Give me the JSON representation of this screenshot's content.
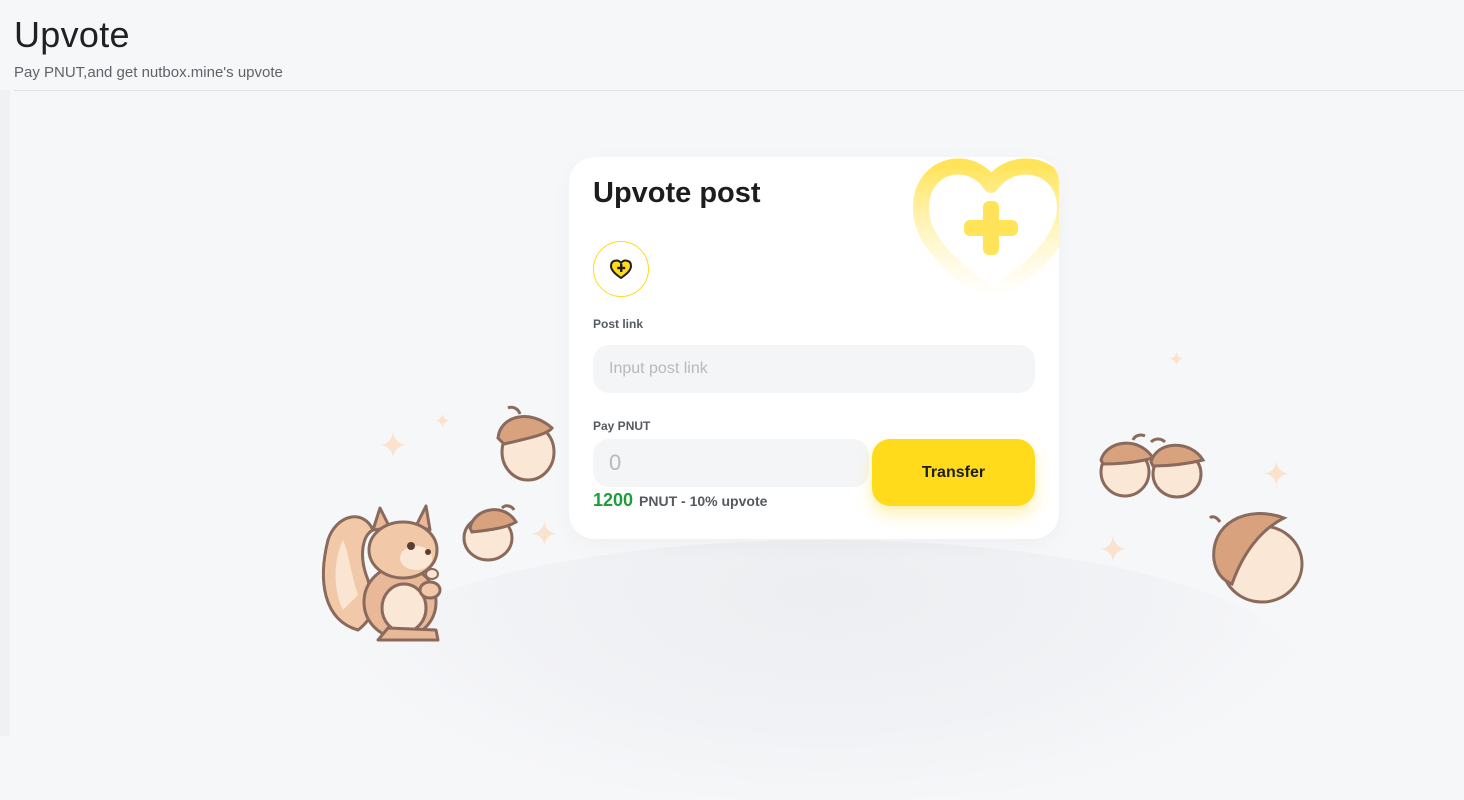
{
  "page": {
    "title": "Upvote",
    "subtitle": "Pay PNUT,and get nutbox.mine's upvote"
  },
  "card": {
    "title": "Upvote post",
    "post_link_label": "Post link",
    "post_link_placeholder": "Input post link",
    "pay_label": "Pay PNUT",
    "pay_placeholder": "0",
    "transfer_label": "Transfer",
    "pay_amount": "1200",
    "pay_description": "PNUT - 10% upvote",
    "icon": "heart-plus-icon"
  },
  "colors": {
    "accent_yellow": "#ffdb1b",
    "amount_green": "#1e9d3b",
    "background": "#f6f7f9"
  }
}
